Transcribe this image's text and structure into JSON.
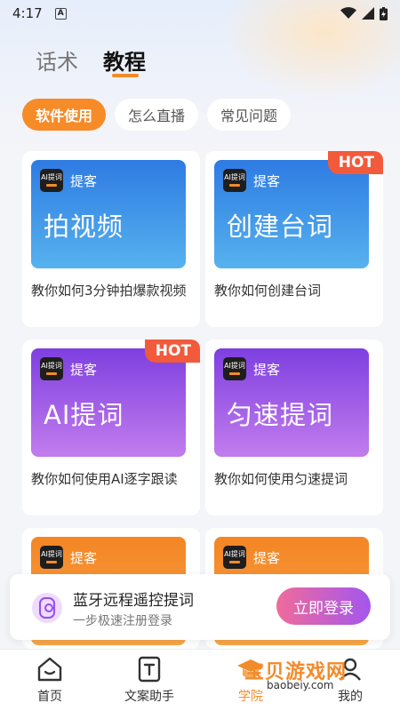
{
  "status": {
    "time": "4:17",
    "notif_icon": "A"
  },
  "tabs": [
    {
      "label": "话术"
    },
    {
      "label": "教程"
    }
  ],
  "chips": [
    {
      "label": "软件使用"
    },
    {
      "label": "怎么直播"
    },
    {
      "label": "常见问题"
    }
  ],
  "cards": [
    {
      "logo_line1": "AI提词",
      "logo_line2": "提客",
      "brand": "提客",
      "title": "拍视频",
      "desc": "教你如何3分钟拍爆款视频",
      "hot": ""
    },
    {
      "logo_line1": "AI提词",
      "logo_line2": "提客",
      "brand": "提客",
      "title": "创建台词",
      "desc": "教你如何创建台词",
      "hot": "HOT"
    },
    {
      "logo_line1": "AI提词",
      "logo_line2": "提客",
      "brand": "提客",
      "title": "AI提词",
      "desc": "教你如何使用AI逐字跟读",
      "hot": "HOT"
    },
    {
      "logo_line1": "AI提词",
      "logo_line2": "提客",
      "brand": "提客",
      "title": "匀速提词",
      "desc": "教你如何使用匀速提词",
      "hot": ""
    },
    {
      "logo_line1": "AI提词",
      "logo_line2": "提客",
      "brand": "提客",
      "title": "",
      "desc": "",
      "hot": ""
    },
    {
      "logo_line1": "AI提词",
      "logo_line2": "提客",
      "brand": "提客",
      "title": "",
      "desc": "",
      "hot": ""
    }
  ],
  "banner": {
    "title": "蓝牙远程遥控提词",
    "subtitle": "一步极速注册登录",
    "button": "立即登录"
  },
  "nav": [
    {
      "label": "首页"
    },
    {
      "label": "文案助手"
    },
    {
      "label": "学院"
    },
    {
      "label": "我的"
    }
  ],
  "watermark": {
    "title": "宝贝游戏网",
    "url": "baobeiy.com"
  }
}
